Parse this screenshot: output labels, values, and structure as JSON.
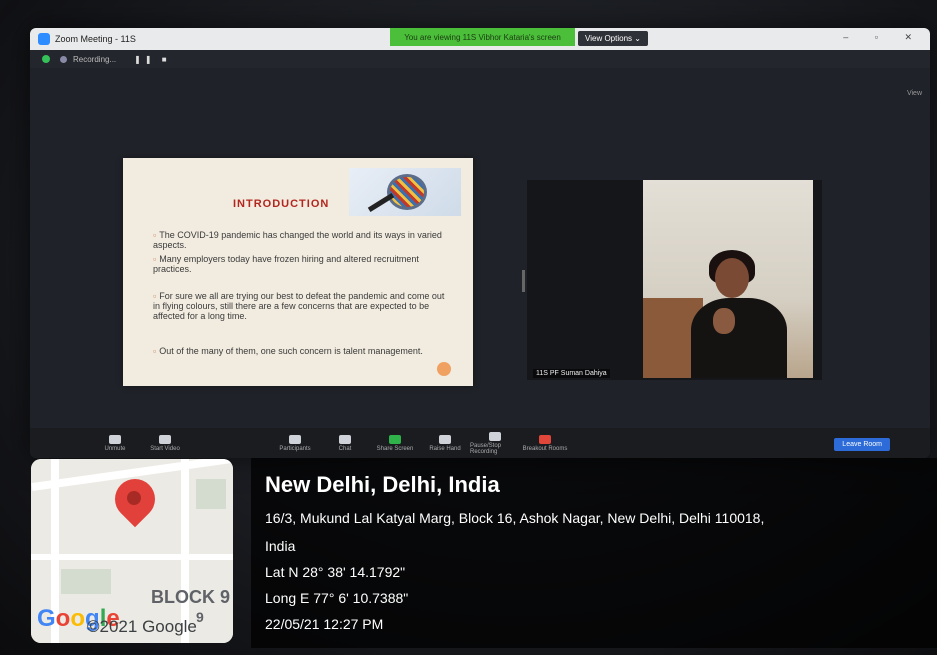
{
  "zoom": {
    "window_title": "Zoom Meeting - 11S",
    "viewing_banner": "You are viewing 11S Vibhor Kataria's screen",
    "view_options": "View Options ⌄",
    "recording_label": "Recording...",
    "view_link": "View",
    "participant_name": "11S PF Suman Dahiya",
    "leave_button": "Leave Room",
    "toolbar": [
      {
        "label": "Unmute",
        "icon": "mic-icon"
      },
      {
        "label": "Start Video",
        "icon": "video-icon"
      },
      {
        "label": "Participants",
        "icon": "participants-icon"
      },
      {
        "label": "Chat",
        "icon": "chat-icon"
      },
      {
        "label": "Share Screen",
        "icon": "share-screen-icon"
      },
      {
        "label": "Raise Hand",
        "icon": "hand-icon"
      },
      {
        "label": "Pause/Stop Recording",
        "icon": "recording-icon"
      },
      {
        "label": "Breakout Rooms",
        "icon": "breakout-icon"
      }
    ]
  },
  "slide": {
    "title": "INTRODUCTION",
    "bullets": [
      "The COVID-19 pandemic has changed the world and its ways in varied aspects.",
      "Many employers today have frozen hiring and altered recruitment practices.",
      "For sure we all are trying our best to defeat the pandemic and come out in flying colours, still there are a few concerns that are expected to be affected for a long time.",
      "Out of the many of them, one such concern is talent management."
    ]
  },
  "map": {
    "block_label": "BLOCK 9",
    "number_label": "9",
    "google_logo": "Google",
    "copyright": "©2021 Google"
  },
  "geotag": {
    "city": "New Delhi, Delhi, India",
    "address_line1": "16/3, Mukund Lal Katyal Marg, Block 16, Ashok Nagar, New Delhi, Delhi 110018,",
    "address_line2": "India",
    "lat": "Lat N 28° 38' 14.1792\"",
    "long": "Long E 77° 6' 10.7388\"",
    "datetime": "22/05/21 12:27 PM"
  }
}
